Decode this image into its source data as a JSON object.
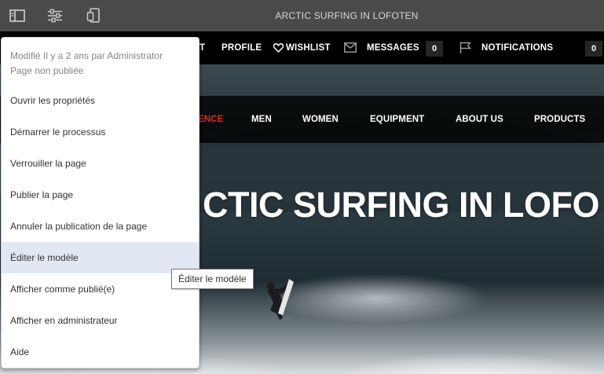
{
  "toolbar": {
    "title": "ARCTIC SURFING IN LOFOTEN",
    "icons": [
      "side-panel-icon",
      "page-information-icon",
      "emulator-icon"
    ]
  },
  "utility_nav": {
    "partial_item": "T",
    "profile": "PROFILE",
    "wishlist": "WISHLIST",
    "messages": "MESSAGES",
    "messages_count": "0",
    "notifications": "NOTIFICATIONS",
    "notifications_count": "0"
  },
  "main_nav": {
    "partial_active": "ENCE",
    "items": [
      "MEN",
      "WOMEN",
      "EQUIPMENT",
      "ABOUT US",
      "PRODUCTS"
    ],
    "active_color": "#e0261a"
  },
  "hero": {
    "title": "CTIC SURFING IN LOFO"
  },
  "page_menu": {
    "status_line1": "Modifié Il y a 2 ans par Administrator",
    "status_line2": "Page non publiée",
    "items": [
      "Ouvrir les propriétés",
      "Démarrer le processus",
      "Verrouiller la page",
      "Publier la page",
      "Annuler la publication de la page",
      "Éditer le modèle",
      "Afficher comme publié(e)",
      "Afficher en administrateur",
      "Aide"
    ],
    "hovered_index": 5
  },
  "tooltip": "Éditer le modèle"
}
